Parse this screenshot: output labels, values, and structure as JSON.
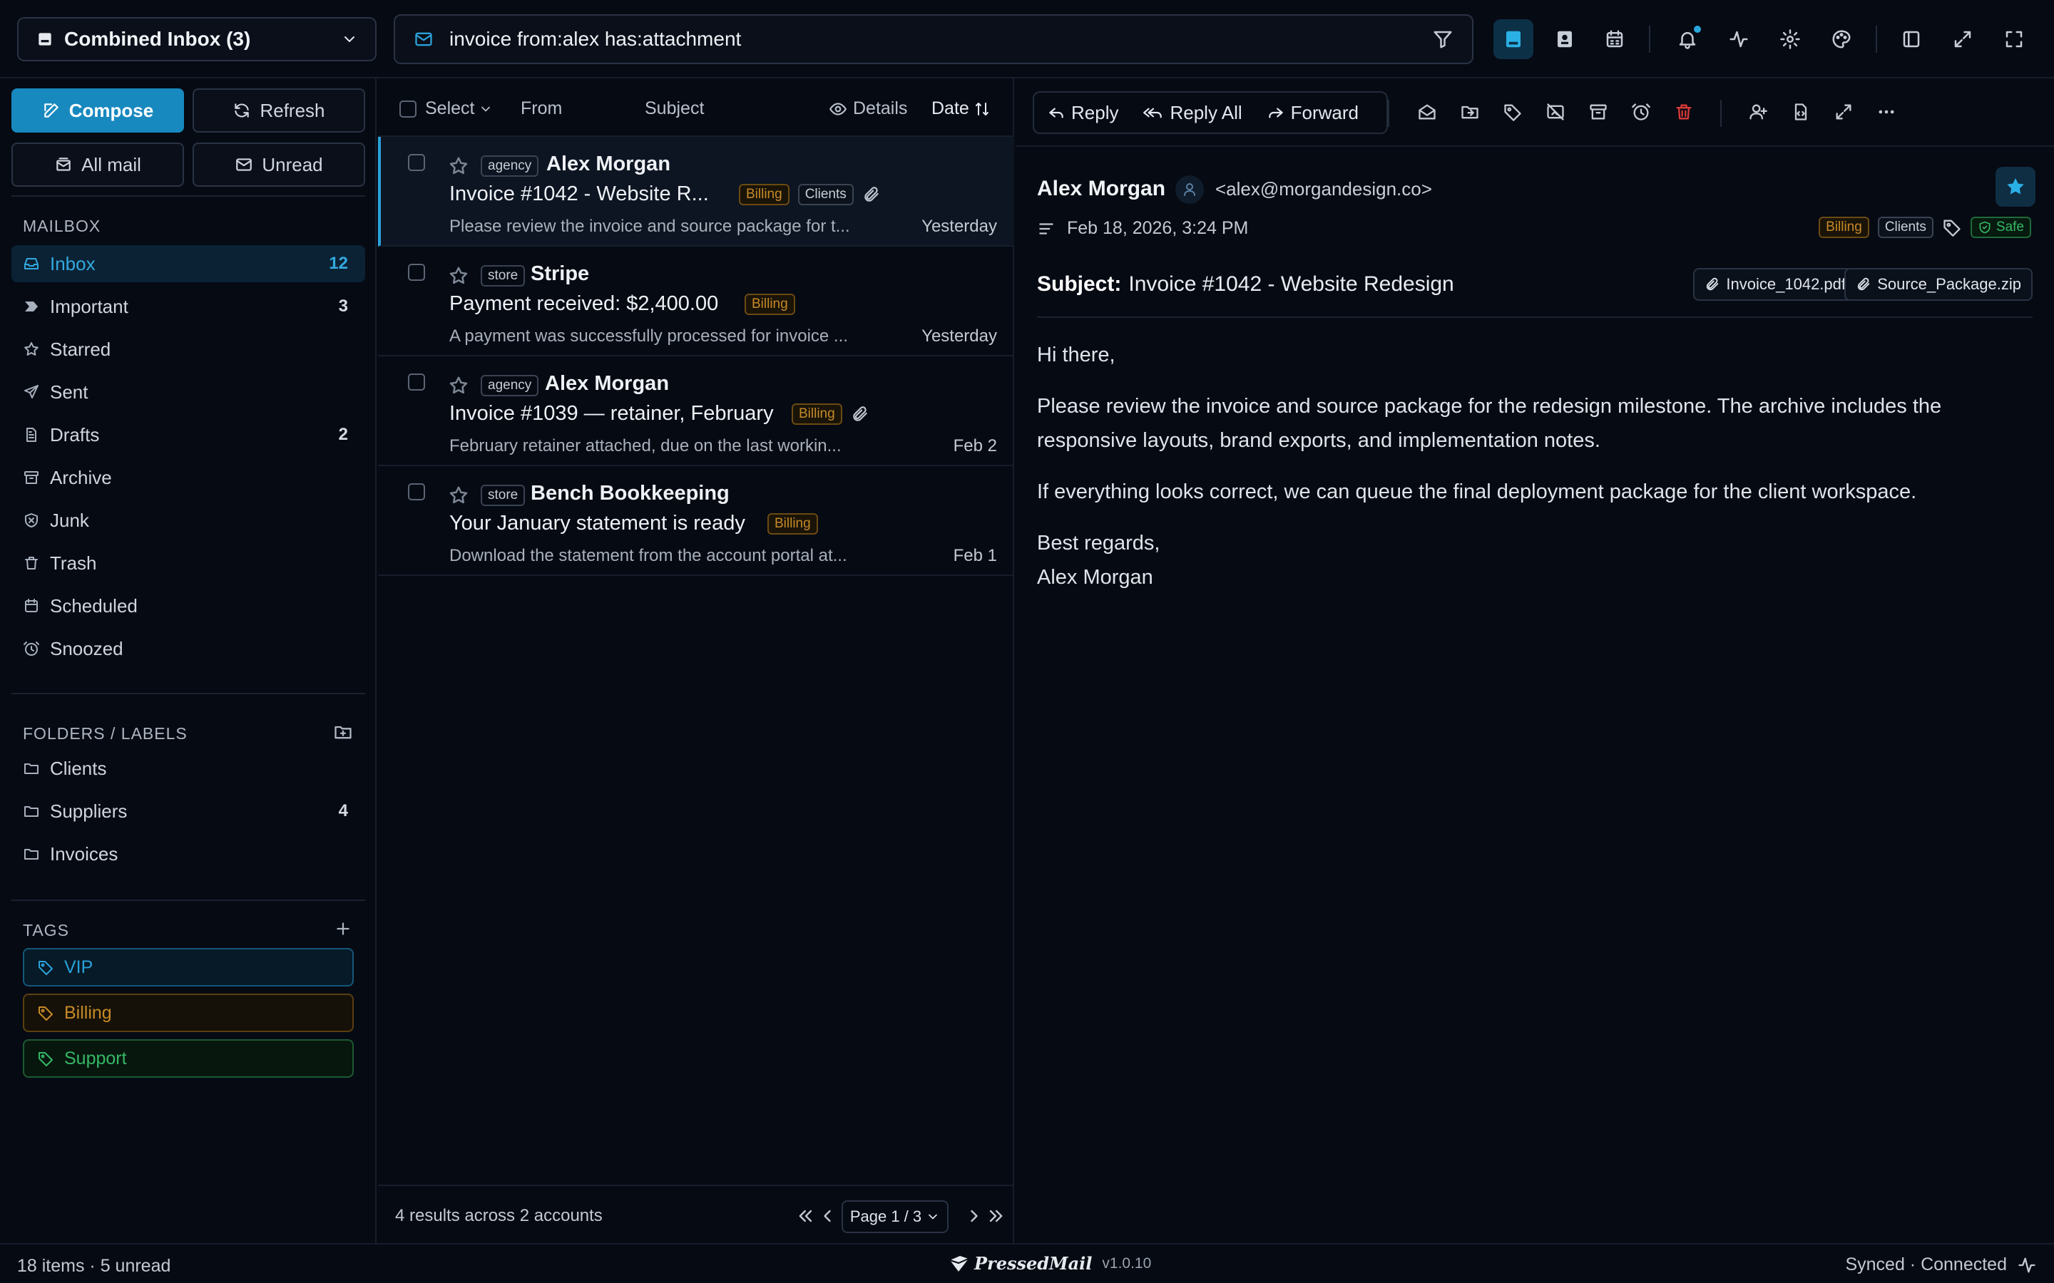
{
  "topbar": {
    "account": "Combined Inbox (3)",
    "search_query": "invoice from:alex has:attachment"
  },
  "sidebar": {
    "compose": "Compose",
    "refresh": "Refresh",
    "all_mail": "All mail",
    "unread": "Unread",
    "mailbox_title": "MAILBOX",
    "mailbox": [
      {
        "label": "Inbox",
        "count": "12",
        "icon": "inbox-icon"
      },
      {
        "label": "Important",
        "count": "3",
        "icon": "important-icon"
      },
      {
        "label": "Starred",
        "count": "",
        "icon": "star-icon"
      },
      {
        "label": "Sent",
        "count": "",
        "icon": "send-icon"
      },
      {
        "label": "Drafts",
        "count": "2",
        "icon": "draft-icon"
      },
      {
        "label": "Archive",
        "count": "",
        "icon": "archive-icon"
      },
      {
        "label": "Junk",
        "count": "",
        "icon": "junk-icon"
      },
      {
        "label": "Trash",
        "count": "",
        "icon": "trash-icon"
      },
      {
        "label": "Scheduled",
        "count": "",
        "icon": "clock-icon"
      },
      {
        "label": "Snoozed",
        "count": "",
        "icon": "snooze-icon"
      }
    ],
    "folders_title": "FOLDERS / LABELS",
    "folders": [
      {
        "label": "Clients",
        "count": ""
      },
      {
        "label": "Suppliers",
        "count": "4"
      },
      {
        "label": "Invoices",
        "count": ""
      }
    ],
    "tags_title": "TAGS",
    "tags": [
      {
        "label": "VIP",
        "color": "#2aa1d9"
      },
      {
        "label": "Billing",
        "color": "#c68a27"
      },
      {
        "label": "Support",
        "color": "#35b865"
      }
    ]
  },
  "list": {
    "select": "Select",
    "from": "From",
    "subject": "Subject",
    "details": "Details",
    "date": "Date",
    "messages": [
      {
        "account": "agency",
        "sender": "Alex Morgan",
        "subject": "Invoice #1042 - Website R...",
        "tags": [
          "Billing",
          "Clients"
        ],
        "attachment": true,
        "preview": "Please review the invoice and source package for t...",
        "date": "Yesterday",
        "selected": true
      },
      {
        "account": "store",
        "sender": "Stripe",
        "subject": "Payment received: $2,400.00",
        "tags": [
          "Billing"
        ],
        "attachment": false,
        "preview": "A payment was successfully processed for invoice ...",
        "date": "Yesterday",
        "selected": false
      },
      {
        "account": "agency",
        "sender": "Alex Morgan",
        "subject": "Invoice #1039 — retainer, February",
        "tags": [
          "Billing"
        ],
        "attachment": true,
        "preview": "February retainer attached, due on the last workin...",
        "date": "Feb 2",
        "selected": false
      },
      {
        "account": "store",
        "sender": "Bench Bookkeeping",
        "subject": "Your January statement is ready",
        "tags": [
          "Billing"
        ],
        "attachment": false,
        "preview": "Download the statement from the account portal at...",
        "date": "Feb 1",
        "selected": false
      }
    ],
    "results": "4 results across 2 accounts",
    "page": "Page 1 / 3"
  },
  "reader": {
    "reply": "Reply",
    "reply_all": "Reply All",
    "forward": "Forward",
    "from_name": "Alex Morgan",
    "from_addr": "<alex@morgandesign.co>",
    "date": "Feb 18, 2026, 3:24 PM",
    "tags": [
      "Billing",
      "Clients"
    ],
    "safe": "Safe",
    "subject_label": "Subject:",
    "subject": "Invoice #1042 - Website Redesign",
    "attachments": [
      "Invoice_1042.pdf",
      "Source_Package.zip"
    ],
    "greeting": "Hi there,",
    "para1": "Please review the invoice and source package for the redesign milestone. The archive includes the responsive layouts, brand exports, and implementation notes.",
    "para2": "If everything looks correct, we can queue the final deployment package for the client workspace.",
    "signoff": "Best regards,",
    "signature": "Alex Morgan"
  },
  "status": {
    "left": "18 items · 5 unread",
    "brand": "PressedMail",
    "version": "v1.0.10",
    "right": "Synced · Connected"
  },
  "colors": {
    "accent": "#1889bf",
    "billing": "#c68a27",
    "safe": "#35b865",
    "danger": "#d93a3a"
  }
}
